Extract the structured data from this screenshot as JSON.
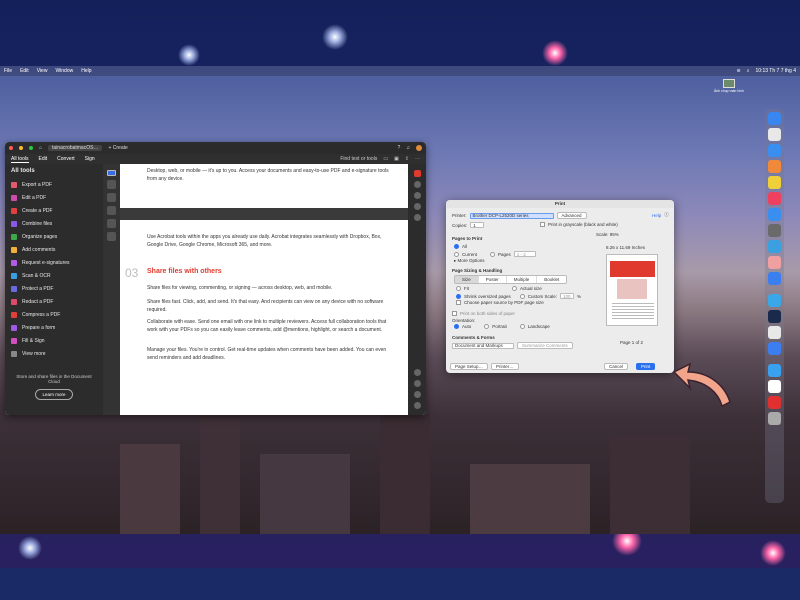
{
  "menubar": {
    "items": [
      "File",
      "Edit",
      "View",
      "Window",
      "Help"
    ],
    "clock": "10:13 Th 7 7 thg 4"
  },
  "desktop_widget": {
    "label": "Ảnh chụp màn hình"
  },
  "acrobat": {
    "tab_title": "tainacrobatmacOS…",
    "create_button": "+ Create",
    "tabs": [
      "All tools",
      "Edit",
      "Convert",
      "Sign"
    ],
    "find_text": "Find text or tools",
    "sidebar_heading": "All tools",
    "tools": [
      {
        "label": "Export a PDF",
        "color": "#e35a6e"
      },
      {
        "label": "Edit a PDF",
        "color": "#d04bb0"
      },
      {
        "label": "Create a PDF",
        "color": "#e04040"
      },
      {
        "label": "Combine files",
        "color": "#8a5ae6"
      },
      {
        "label": "Organize pages",
        "color": "#3aa84b"
      },
      {
        "label": "Add comments",
        "color": "#f0b13a"
      },
      {
        "label": "Request e-signatures",
        "color": "#b35ae6"
      },
      {
        "label": "Scan & OCR",
        "color": "#3a9ee0"
      },
      {
        "label": "Protect a PDF",
        "color": "#6a6ae0"
      },
      {
        "label": "Redact a PDF",
        "color": "#e04a6a"
      },
      {
        "label": "Compress a PDF",
        "color": "#e0403a"
      },
      {
        "label": "Prepare a form",
        "color": "#a05ae6"
      },
      {
        "label": "Fill & Sign",
        "color": "#d050c0"
      },
      {
        "label": "View more",
        "color": "#888888"
      }
    ],
    "cloud_text": "Store and share files in the Document Cloud",
    "learn_more": "Learn more",
    "doc": {
      "top_text": "Desktop, web, or mobile — it's up to you. Access your documents and easy-to-use PDF and e-signature tools from any device.",
      "para1": "Use Acrobat tools within the apps you already use daily. Acrobat integrates seamlessly with Dropbox, Box, Google Drive, Google Chrome, Microsoft 365, and more.",
      "section_number": "03",
      "section_title": "Share files with others",
      "para2": "Share files for viewing, commenting, or signing — across desktop, web, and mobile.",
      "para3": "Share files fast. Click, add, and send. It's that easy. And recipients can view on any device with no software required.",
      "para4": "Collaborate with ease. Send one email with one link to multiple reviewers. Access full collaboration tools that work with your PDFs so you can easily leave comments, add @mentions, highlight, or search a document.",
      "para5": "Manage your files. You're in control. Get real-time updates when comments have been added. You can even send reminders and add deadlines."
    }
  },
  "print_dialog": {
    "title": "Print",
    "printer_label": "Printer:",
    "printer_value": "Brother DCP-L2520D series",
    "advanced": "Advanced",
    "help": "Help",
    "copies_label": "Copies:",
    "copies_value": "1",
    "grayscale": "Print in grayscale (black and white)",
    "pages_heading": "Pages to Print",
    "pages_options": [
      "All",
      "Current",
      "Pages"
    ],
    "pages_range": "1 - 2",
    "more_options": "▸ More Options",
    "sizing_heading": "Page Sizing & Handling",
    "sizing_tabs": [
      "Size",
      "Poster",
      "Multiple",
      "Booklet"
    ],
    "fit": "Fit",
    "actual": "Actual size",
    "shrink": "Shrink oversized pages",
    "custom_scale": "Custom Scale:",
    "custom_scale_value": "100",
    "paper_source": "Choose paper source by PDF page size",
    "both_sides": "Print on both sides of paper",
    "orientation_heading": "Orientation:",
    "orientation_options": [
      "Auto",
      "Portrait",
      "Landscape"
    ],
    "comments_heading": "Comments & Forms",
    "comments_value": "Document and Markups",
    "summarize": "Summarize Comments",
    "scale": "Scale: 95%",
    "dimensions": "8.26 x 11.69 Inches",
    "page_of": "Page 1 of 2",
    "page_setup": "Page Setup…",
    "printer_btn": "Printer…",
    "cancel": "Cancel",
    "print": "Print"
  },
  "dock": {
    "colors": [
      "#3a86f0",
      "#e8e8e8",
      "#3a8ef0",
      "#f08a3a",
      "#f0d03a",
      "#f04060",
      "#3a8ef0",
      "#6a6a6a",
      "#3aa0e0",
      "#f0a0a0",
      "#3a7ef0",
      "#3aa8e8",
      "#1a2a4a",
      "#e8e8e8",
      "#3a7ef0",
      "#3aa0f0",
      "#ffffff",
      "#e03030",
      "#aaaaaa"
    ]
  }
}
